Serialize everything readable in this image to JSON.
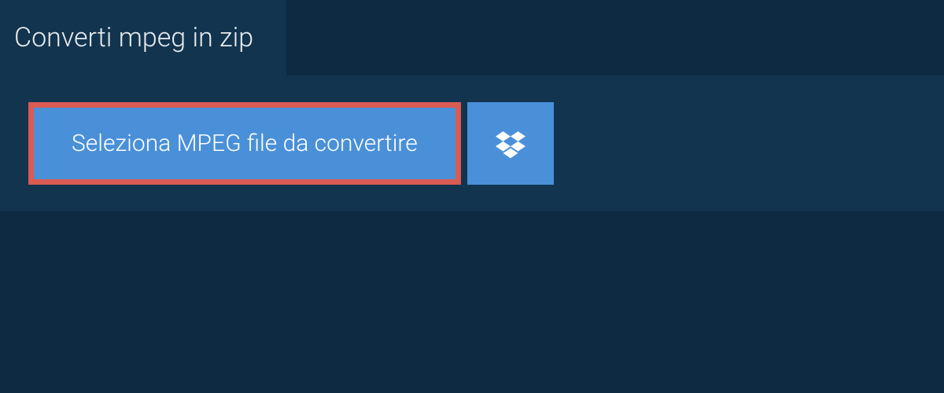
{
  "tab": {
    "label": "Converti mpeg in zip"
  },
  "panel": {
    "select_button_label": "Seleziona MPEG file da convertire"
  },
  "colors": {
    "background": "#0e2a42",
    "panel": "#12344f",
    "button": "#4a90d9",
    "highlight_border": "#d95b52",
    "text": "#ffffff"
  }
}
